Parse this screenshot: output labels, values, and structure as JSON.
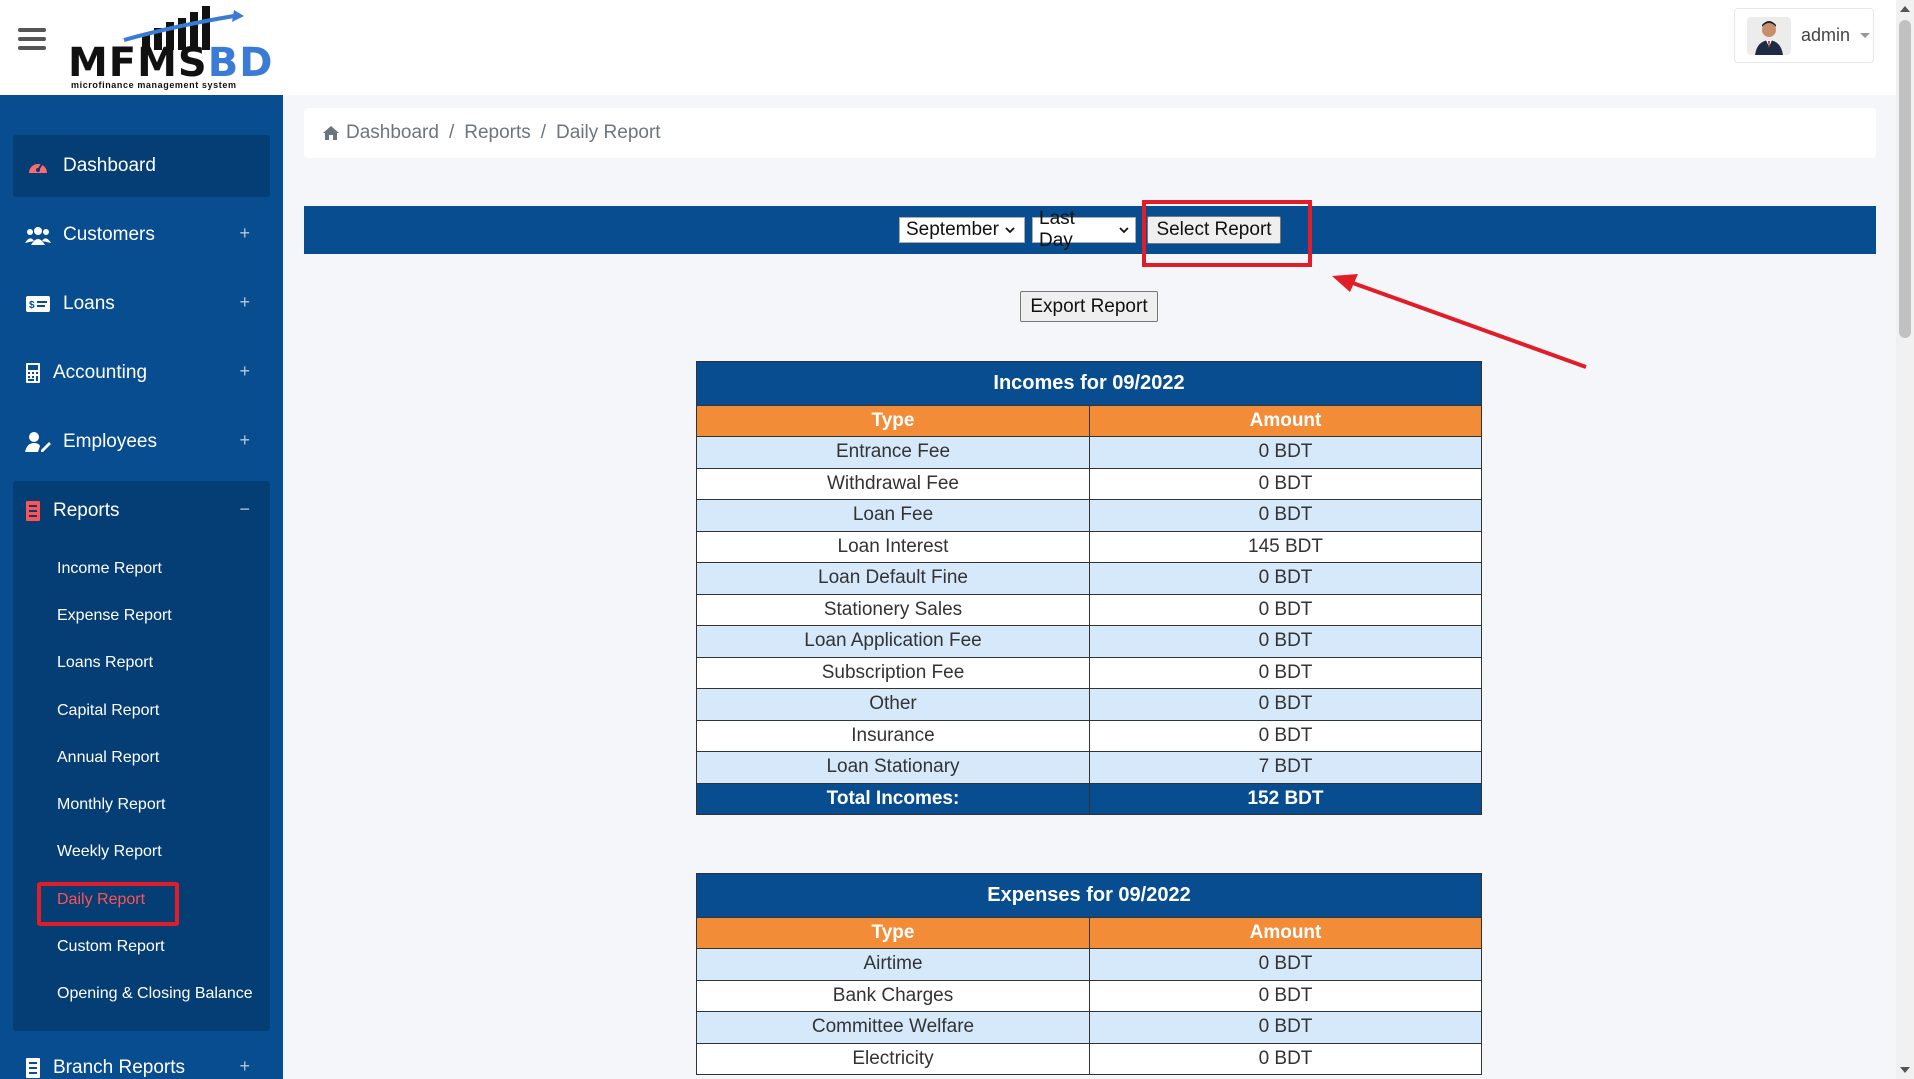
{
  "brand": {
    "logo_main": "MFMS",
    "logo_accent": "BD",
    "tagline": "microfinance management system"
  },
  "user": {
    "name": "admin"
  },
  "sidebar": {
    "items": [
      {
        "label": "Dashboard"
      },
      {
        "label": "Customers"
      },
      {
        "label": "Loans"
      },
      {
        "label": "Accounting"
      },
      {
        "label": "Employees"
      },
      {
        "label": "Reports"
      },
      {
        "label": "Branch Reports"
      }
    ],
    "report_subitems": [
      "Income Report",
      "Expense Report",
      "Loans Report",
      "Capital Report",
      "Annual Report",
      "Monthly Report",
      "Weekly Report",
      "Daily Report",
      "Custom Report",
      "Opening & Closing Balance"
    ],
    "expand_symbol": "+",
    "collapse_symbol": "−"
  },
  "breadcrumb": {
    "home": "Dashboard",
    "parent": "Reports",
    "current": "Daily Report",
    "separator": "/"
  },
  "filters": {
    "month": "September",
    "day": "Last Day",
    "select_button": "Select Report"
  },
  "export_button": "Export Report",
  "incomes": {
    "title": "Incomes for 09/2022",
    "col_type": "Type",
    "col_amount": "Amount",
    "rows": [
      {
        "type": "Entrance Fee",
        "amount": "0 BDT"
      },
      {
        "type": "Withdrawal Fee",
        "amount": "0 BDT"
      },
      {
        "type": "Loan Fee",
        "amount": "0 BDT"
      },
      {
        "type": "Loan Interest",
        "amount": "145 BDT"
      },
      {
        "type": "Loan Default Fine",
        "amount": "0 BDT"
      },
      {
        "type": "Stationery Sales",
        "amount": "0 BDT"
      },
      {
        "type": "Loan Application Fee",
        "amount": "0 BDT"
      },
      {
        "type": "Subscription Fee",
        "amount": "0 BDT"
      },
      {
        "type": "Other",
        "amount": "0 BDT"
      },
      {
        "type": "Insurance",
        "amount": "0 BDT"
      },
      {
        "type": "Loan Stationary",
        "amount": "7 BDT"
      }
    ],
    "total_label": "Total Incomes:",
    "total_value": "152 BDT"
  },
  "expenses": {
    "title": "Expenses for 09/2022",
    "col_type": "Type",
    "col_amount": "Amount",
    "rows": [
      {
        "type": "Airtime",
        "amount": "0 BDT"
      },
      {
        "type": "Bank Charges",
        "amount": "0 BDT"
      },
      {
        "type": "Committee Welfare",
        "amount": "0 BDT"
      },
      {
        "type": "Electricity",
        "amount": "0 BDT"
      }
    ]
  },
  "colors": {
    "primary": "#084d8f",
    "header_orange": "#f28c36",
    "row_alt": "#d6e9fb",
    "highlight": "#e11d2a"
  }
}
